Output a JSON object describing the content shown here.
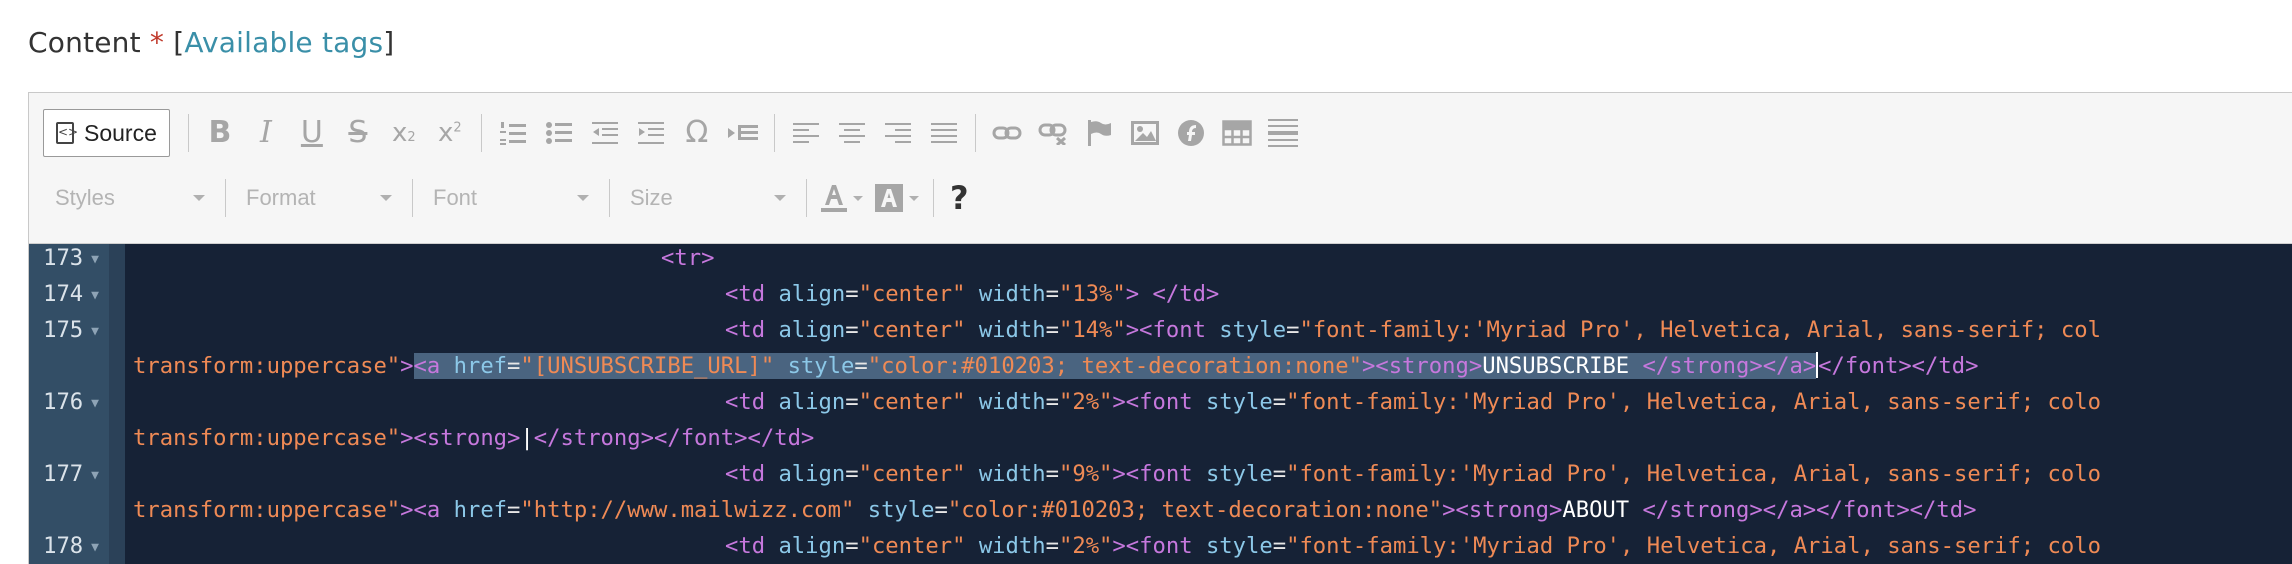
{
  "label": {
    "text": "Content",
    "required_mark": "*",
    "open_bracket": "[",
    "link": "Available tags",
    "close_bracket": "]"
  },
  "toolbar": {
    "source_label": "Source",
    "styles_label": "Styles",
    "format_label": "Format",
    "font_label": "Font",
    "size_label": "Size",
    "help_label": "?"
  },
  "code": {
    "lines": [
      {
        "n": "173",
        "wrapped": false
      },
      {
        "n": "174",
        "wrapped": false
      },
      {
        "n": "175",
        "wrapped": true
      },
      {
        "n": "176",
        "wrapped": true
      },
      {
        "n": "177",
        "wrapped": true
      },
      {
        "n": "178",
        "wrapped": false
      }
    ],
    "t173_tag": "<tr>",
    "t174": {
      "open": "<td",
      "a1": "align",
      "v1": "\"center\"",
      "a2": "width",
      "v2": "\"13%\"",
      "close": "> </td>"
    },
    "t175": {
      "open": "<td",
      "a1": "align",
      "v1": "\"center\"",
      "a2": "width",
      "v2": "\"14%\"",
      "font_open": "><font",
      "a3": "style",
      "v3": "\"font-family:'Myriad Pro', Helvetica, Arial, sans-serif; col",
      "w_v3": "transform:uppercase\"",
      "a_open": "<a",
      "a4": "href",
      "v4": "\"[UNSUBSCRIBE_URL]\"",
      "a5": "style",
      "v5": "\"color:#010203; text-decoration:none\"",
      "strong_open": "><strong>",
      "text": "UNSUBSCRIBE ",
      "strong_close": "</strong></a>",
      "a_end": "</font></td>"
    },
    "t176": {
      "open": "<td",
      "a1": "align",
      "v1": "\"center\"",
      "a2": "width",
      "v2": "\"2%\"",
      "font_open": "><font",
      "a3": "style",
      "v3": "\"font-family:'Myriad Pro', Helvetica, Arial, sans-serif; colo",
      "w_v3": "transform:uppercase\"",
      "strong_open": "><strong>",
      "text": "|",
      "close": "</strong></font></td>"
    },
    "t177": {
      "open": "<td",
      "a1": "align",
      "v1": "\"center\"",
      "a2": "width",
      "v2": "\"9%\"",
      "font_open": "><font",
      "a3": "style",
      "v3": "\"font-family:'Myriad Pro', Helvetica, Arial, sans-serif; colo",
      "w_v3": "transform:uppercase\"",
      "a_open": "><a",
      "a4": "href",
      "v4": "\"http://www.mailwizz.com\"",
      "a5": "style",
      "v5": "\"color:#010203; text-decoration:none\"",
      "strong_open": "><strong>",
      "text": "ABOUT ",
      "close": "</strong></a></font></td>"
    },
    "t178": {
      "open": "<td",
      "a1": "align",
      "v1": "\"center\"",
      "a2": "width",
      "v2": "\"2%\"",
      "font_open": "><font",
      "a3": "style",
      "v3": "\"font-family:'Myriad Pro', Helvetica, Arial, sans-serif; colo"
    }
  }
}
